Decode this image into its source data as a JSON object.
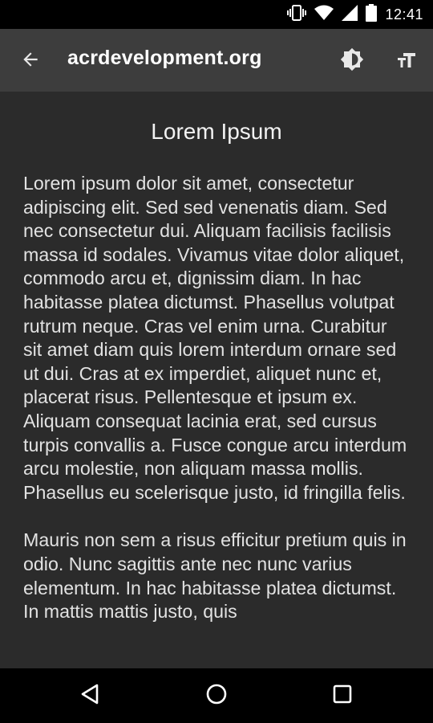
{
  "status_bar": {
    "time": "12:41",
    "icons": [
      "vibrate-icon",
      "wifi-icon",
      "cell-signal-icon",
      "battery-icon"
    ]
  },
  "toolbar": {
    "back_icon": "arrow-back-icon",
    "title": "acrdevelopment.org",
    "brightness_icon": "brightness-icon",
    "text_size_icon": "text-size-icon",
    "background_color": "#3d3d3d"
  },
  "article": {
    "title": "Lorem Ipsum",
    "paragraphs": [
      "Lorem ipsum dolor sit amet, consectetur adipiscing elit. Sed sed venenatis diam. Sed nec consectetur dui. Aliquam facilisis facilisis massa id sodales. Vivamus vitae dolor aliquet, commodo arcu et, dignissim diam. In hac habitasse platea dictumst. Phasellus volutpat rutrum neque. Cras vel enim urna. Curabitur sit amet diam quis lorem interdum ornare sed ut dui. Cras at ex imperdiet, aliquet nunc et, placerat risus. Pellentesque et ipsum ex. Aliquam consequat lacinia erat, sed cursus turpis convallis a. Fusce congue arcu interdum arcu molestie, non aliquam massa mollis. Phasellus eu scelerisque justo, id fringilla felis.",
      "Mauris non sem a risus efficitur pretium quis in odio. Nunc sagittis ante nec nunc varius elementum. In hac habitasse platea dictumst. In mattis mattis justo, quis"
    ],
    "background_color": "#2b2b2b",
    "text_color": "#e2e2e2"
  },
  "nav_bar": {
    "icons": [
      "back-triangle-icon",
      "home-circle-icon",
      "recents-square-icon"
    ]
  }
}
